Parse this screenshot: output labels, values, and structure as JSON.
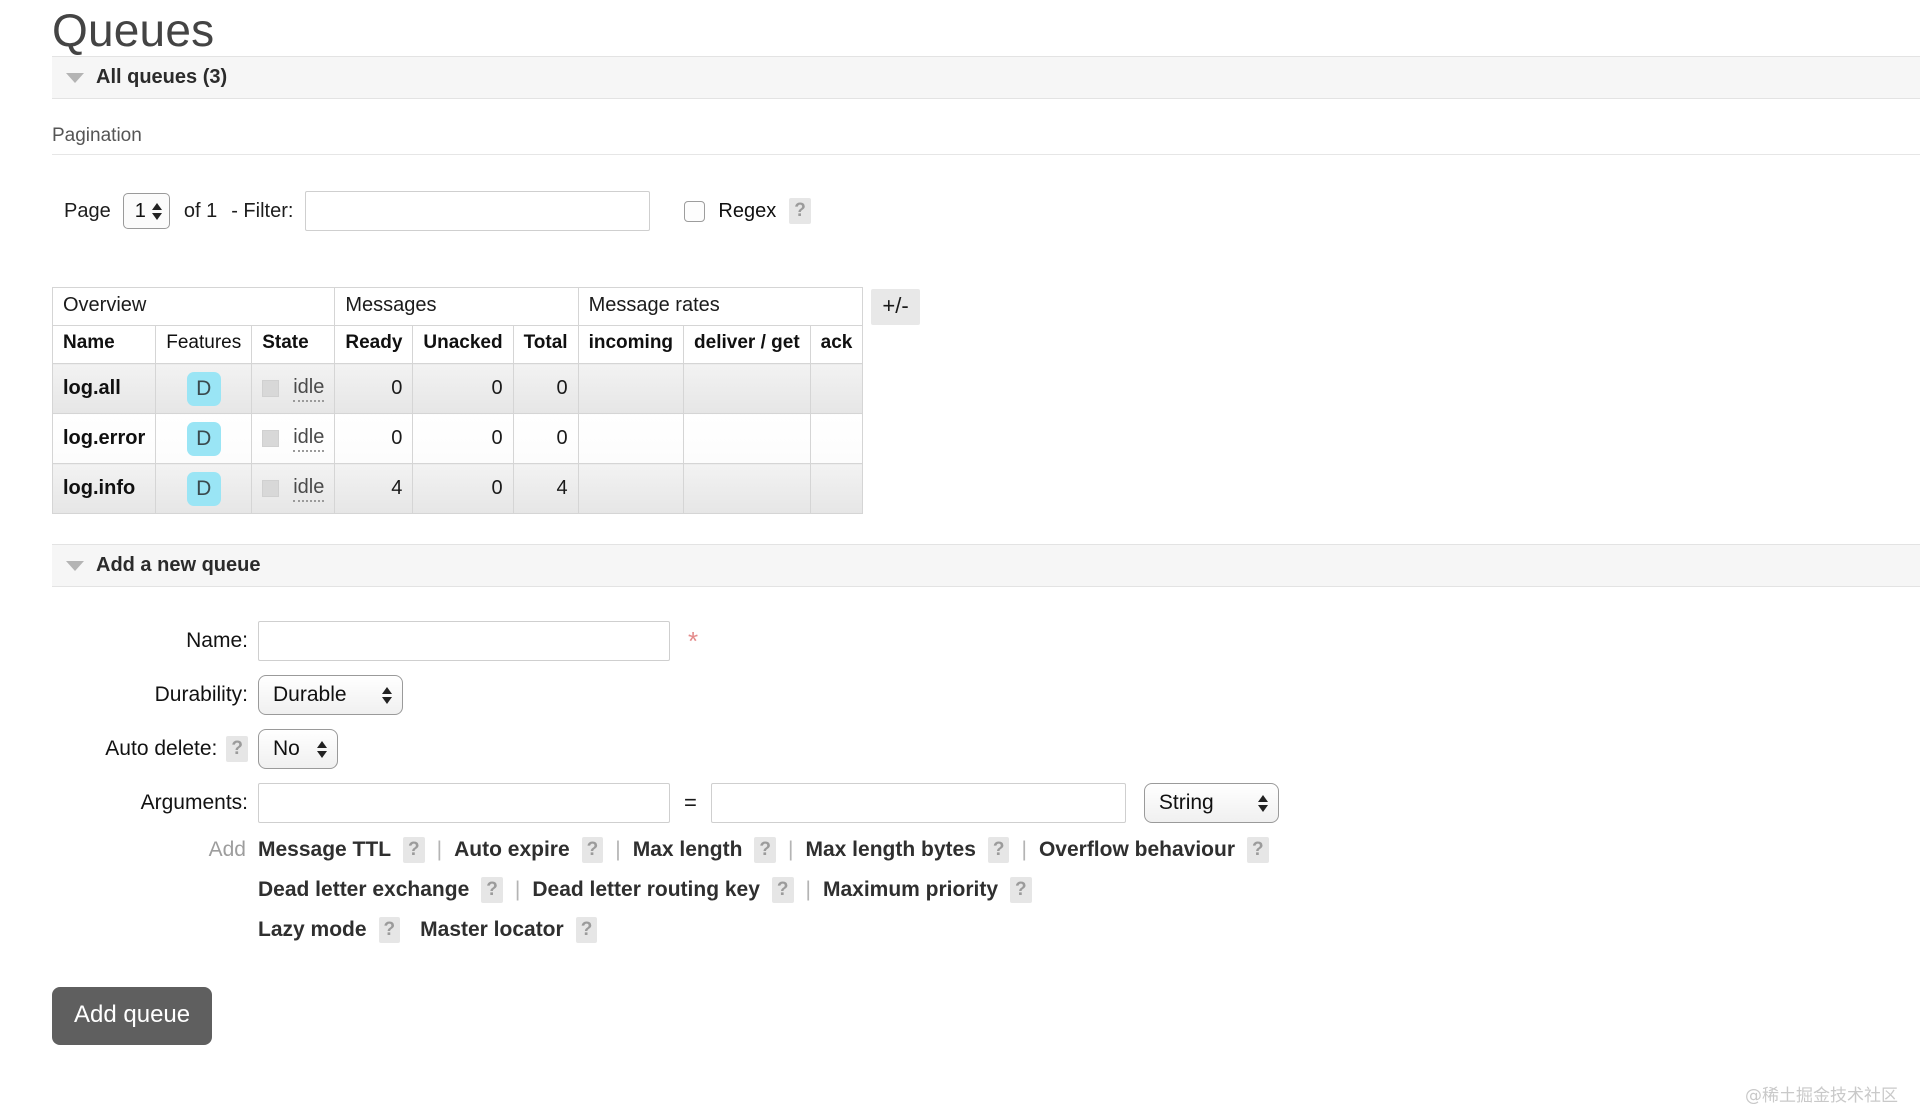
{
  "page": {
    "title": "Queues"
  },
  "all_queues_section": {
    "title": "All queues (3)",
    "toggle_icon": "triangle-down-icon"
  },
  "pagination": {
    "legend": "Pagination",
    "page_label": "Page",
    "page_value": "1",
    "of_label": "of 1",
    "filter_label": "- Filter:",
    "filter_value": "",
    "filter_placeholder": "",
    "regex_label": "Regex",
    "regex_checked": false,
    "regex_help": "?"
  },
  "table": {
    "group_headers": [
      "Overview",
      "Messages",
      "Message rates"
    ],
    "columns": [
      "Name",
      "Features",
      "State",
      "Ready",
      "Unacked",
      "Total",
      "incoming",
      "deliver / get",
      "ack"
    ],
    "toggle_columns_button": "+/-",
    "rows": [
      {
        "name": "log.all",
        "features": "D",
        "state": "idle",
        "ready": "0",
        "unacked": "0",
        "total": "0",
        "incoming": "",
        "deliver_get": "",
        "ack": ""
      },
      {
        "name": "log.error",
        "features": "D",
        "state": "idle",
        "ready": "0",
        "unacked": "0",
        "total": "0",
        "incoming": "",
        "deliver_get": "",
        "ack": ""
      },
      {
        "name": "log.info",
        "features": "D",
        "state": "idle",
        "ready": "4",
        "unacked": "0",
        "total": "4",
        "incoming": "",
        "deliver_get": "",
        "ack": ""
      }
    ]
  },
  "add_queue_section": {
    "title": "Add a new queue",
    "toggle_icon": "triangle-down-icon",
    "name_label": "Name:",
    "name_value": "",
    "name_required_marker": "*",
    "durability_label": "Durability:",
    "durability_value": "Durable",
    "auto_delete_label": "Auto delete:",
    "auto_delete_help": "?",
    "auto_delete_value": "No",
    "arguments_label": "Arguments:",
    "arg_key_value": "",
    "equals": "=",
    "arg_val_value": "",
    "arg_type_value": "String",
    "add_label": "Add",
    "separator": "|",
    "help_glyph": "?",
    "preset_rows": [
      [
        {
          "label": "Message TTL",
          "help": "?",
          "sep_after": true
        },
        {
          "label": "Auto expire",
          "help": "?",
          "sep_after": true
        },
        {
          "label": "Max length",
          "help": "?",
          "sep_after": true
        },
        {
          "label": "Max length bytes",
          "help": "?",
          "sep_after": true
        },
        {
          "label": "Overflow behaviour",
          "help": "?",
          "sep_after": false
        }
      ],
      [
        {
          "label": "Dead letter exchange",
          "help": "?",
          "sep_after": true
        },
        {
          "label": "Dead letter routing key",
          "help": "?",
          "sep_after": true
        },
        {
          "label": "Maximum priority",
          "help": "?",
          "sep_after": false
        }
      ],
      [
        {
          "label": "Lazy mode",
          "help": "?",
          "sep_after": false
        },
        {
          "label": "Master locator",
          "help": "?",
          "sep_after": false
        }
      ]
    ],
    "submit_label": "Add queue"
  },
  "watermark": {
    "text": "@稀土掘金技术社区"
  },
  "colors": {
    "feature_badge_bg": "#9ae5f5",
    "section_bar_bg": "#f6f6f6",
    "submit_button_bg": "#5f5f5f",
    "required_star": "#e48b8b",
    "row_alt_bg": "#ebebeb"
  }
}
